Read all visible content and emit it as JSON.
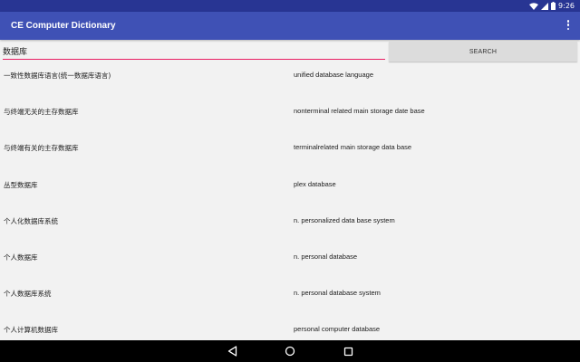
{
  "status_bar": {
    "time": "9:26"
  },
  "app_bar": {
    "title": "CE Computer Dictionary"
  },
  "search": {
    "value": "数据库",
    "button_label": "SEARCH"
  },
  "results": [
    {
      "term": "一致性数据库语言(统一数据库语言)",
      "definition": "unified database language"
    },
    {
      "term": "与终端无关的主存数据库",
      "definition": "nonterminal related main storage date base"
    },
    {
      "term": "与终端有关的主存数据库",
      "definition": "terminalrelated main storage data base"
    },
    {
      "term": "丛型数据库",
      "definition": "plex database"
    },
    {
      "term": "个人化数据库系统",
      "definition": "n. personalized data base system"
    },
    {
      "term": "个人数据库",
      "definition": "n. personal database"
    },
    {
      "term": "个人数据库系统",
      "definition": "n. personal database system"
    },
    {
      "term": "个人计算机数据库",
      "definition": "personal computer database"
    }
  ],
  "colors": {
    "app_bar": "#3f51b5",
    "status_bar": "#283593",
    "input_underline": "#e91e63",
    "button": "#dcdcdc",
    "background": "#f2f2f2"
  }
}
